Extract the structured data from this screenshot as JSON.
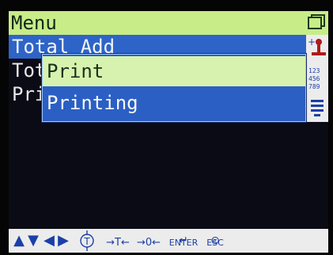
{
  "title": "Menu",
  "colors": {
    "title_bar": "#c8ec88",
    "selection": "#2e64c8",
    "popup_highlight": "#d7f2ae",
    "key_color": "#1b3fa8"
  },
  "menu": {
    "items": [
      {
        "label": "Total Add",
        "selected": true
      },
      {
        "label": "Total Clear",
        "selected": false
      },
      {
        "label": "Print",
        "selected": false
      }
    ]
  },
  "popup": {
    "items": [
      {
        "label": "Print",
        "selected": true
      },
      {
        "label": "Printing",
        "selected": false
      }
    ]
  },
  "strip_icons": [
    "scale-plus-icon",
    "numbers-icon",
    "list-icon"
  ],
  "strip_numbers": [
    "123",
    "456",
    "789"
  ],
  "keys": {
    "up": "▲",
    "down": "▼",
    "left": "◀",
    "right": "▶",
    "tare_label": "T",
    "tare_arrows": "⇧",
    "t_plus": "→T←",
    "zero": "→0←",
    "enter": "ENTER",
    "esc": "ESC"
  }
}
